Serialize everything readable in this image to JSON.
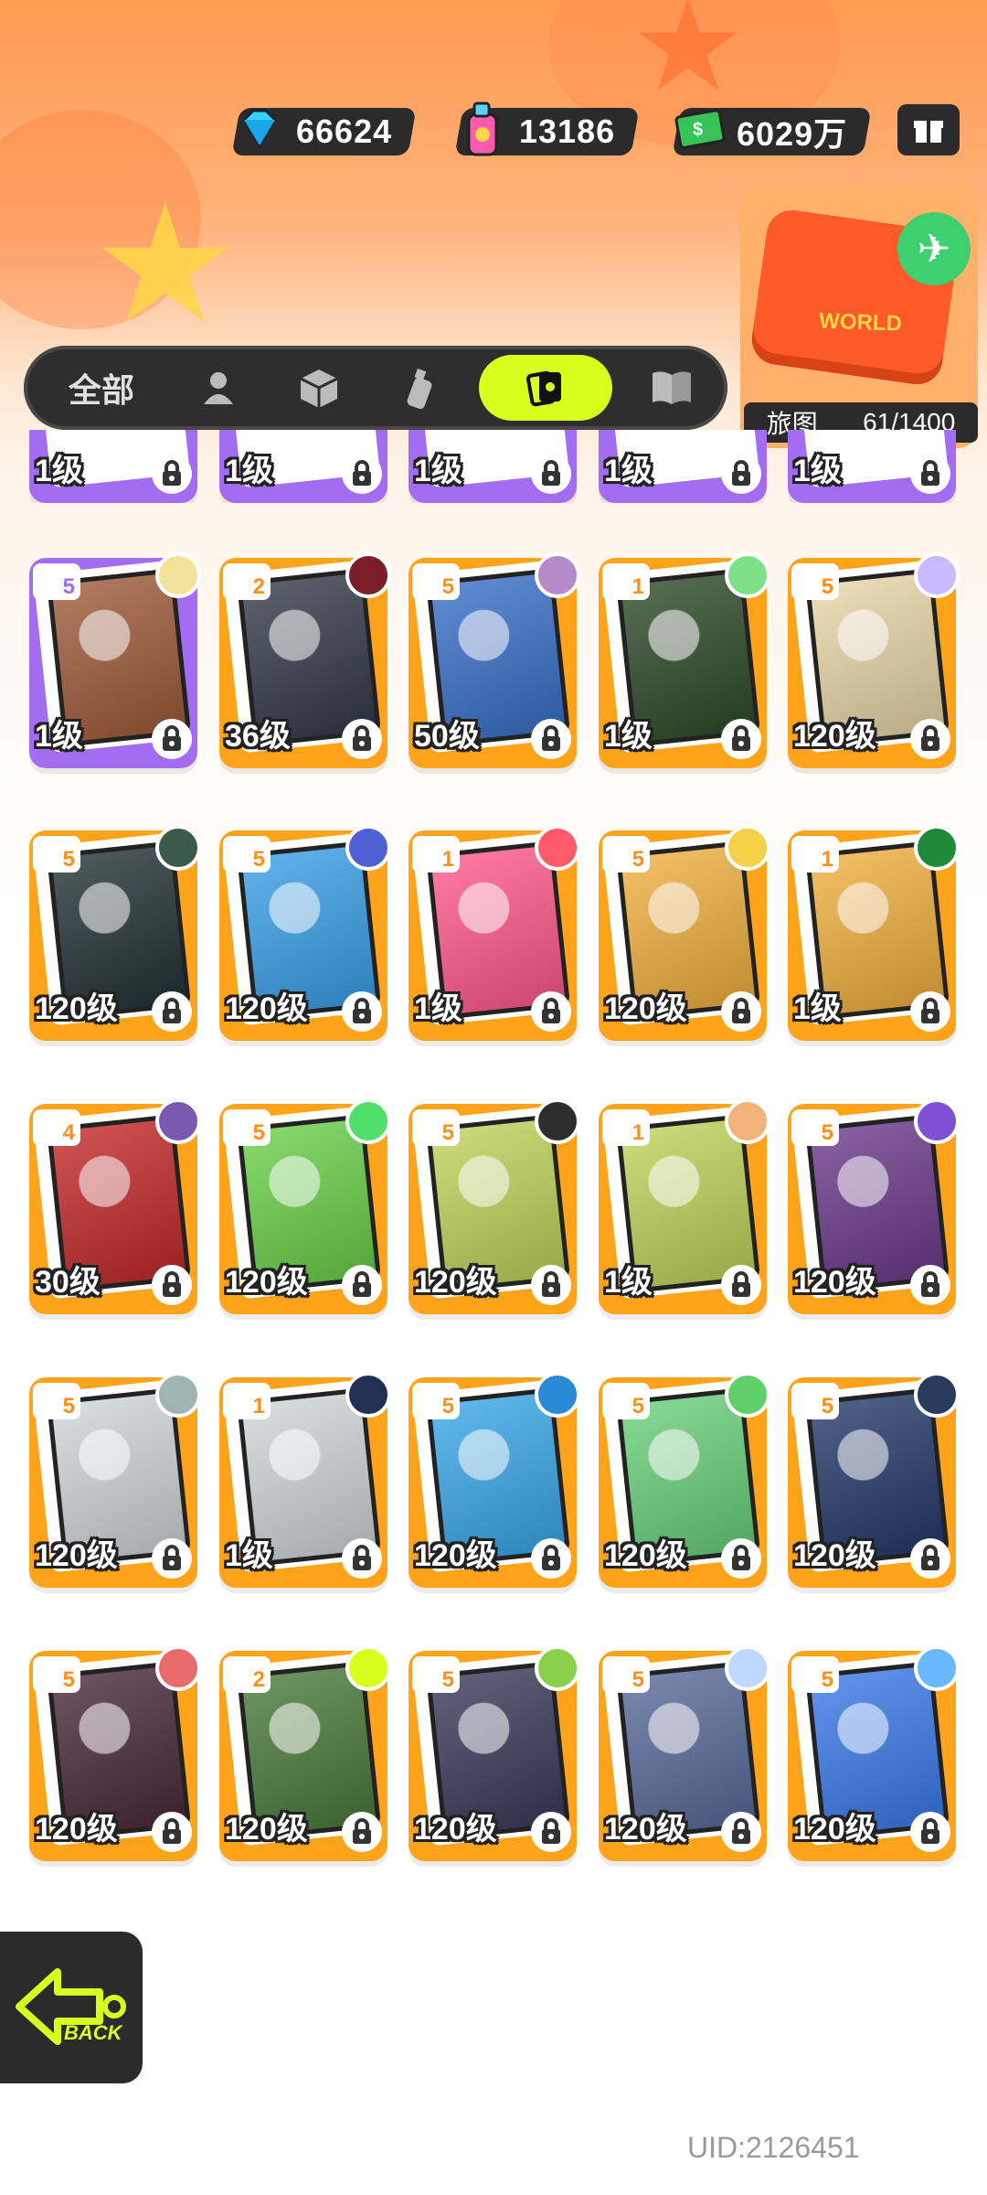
{
  "currencies": {
    "diamonds": "66624",
    "spray": "13186",
    "cash": "6029万"
  },
  "world": {
    "label": "旅图",
    "progress_text": "61/1400",
    "badge_text": "WORLD"
  },
  "tabs": [
    {
      "label": "全部",
      "icon": "all",
      "active": false
    },
    {
      "label": "",
      "icon": "person-icon",
      "active": false
    },
    {
      "label": "",
      "icon": "box-icon",
      "active": false
    },
    {
      "label": "",
      "icon": "spray-can-icon",
      "active": false
    },
    {
      "label": "",
      "icon": "cards-icon",
      "active": true
    },
    {
      "label": "",
      "icon": "book-icon",
      "active": false
    }
  ],
  "cards_top_partial": [
    {
      "level": "1级",
      "color": "purple"
    },
    {
      "level": "1级",
      "color": "purple"
    },
    {
      "level": "1级",
      "color": "purple"
    },
    {
      "level": "1级",
      "color": "purple"
    },
    {
      "level": "1级",
      "color": "purple"
    }
  ],
  "cards": [
    [
      {
        "level": "1级",
        "badge": "5",
        "color": "purple",
        "art": "#a05a3a",
        "avatar": "#f3e29a"
      },
      {
        "level": "36级",
        "badge": "2",
        "color": "orange",
        "art": "#333a4a",
        "avatar": "#7a1f2a"
      },
      {
        "level": "50级",
        "badge": "5",
        "color": "orange",
        "art": "#3a6fc9",
        "avatar": "#b58acb"
      },
      {
        "level": "1级",
        "badge": "1",
        "color": "orange",
        "art": "#2f4a2a",
        "avatar": "#7fe08a"
      },
      {
        "level": "120级",
        "badge": "5",
        "color": "orange",
        "art": "#e9d6a9",
        "avatar": "#c9b9ff"
      }
    ],
    [
      {
        "level": "120级",
        "badge": "5",
        "color": "orange",
        "art": "#243238",
        "avatar": "#3b5a4a"
      },
      {
        "level": "120级",
        "badge": "5",
        "color": "orange",
        "art": "#3aa0e8",
        "avatar": "#4f5fd6"
      },
      {
        "level": "1级",
        "badge": "1",
        "color": "orange",
        "art": "#ff5a8a",
        "avatar": "#ff5a6a"
      },
      {
        "level": "120级",
        "badge": "5",
        "color": "orange",
        "art": "#f0b040",
        "avatar": "#f7d04a"
      },
      {
        "level": "1级",
        "badge": "1",
        "color": "orange",
        "art": "#f0b040",
        "avatar": "#1f8a3a"
      }
    ],
    [
      {
        "level": "30级",
        "badge": "4",
        "color": "orange",
        "art": "#c22a2a",
        "avatar": "#7a5ab0"
      },
      {
        "level": "120级",
        "badge": "5",
        "color": "orange",
        "art": "#6ad04a",
        "avatar": "#4ee06a"
      },
      {
        "level": "120级",
        "badge": "5",
        "color": "orange",
        "art": "#c0d35a",
        "avatar": "#2d2d2d"
      },
      {
        "level": "1级",
        "badge": "1",
        "color": "orange",
        "art": "#c0d35a",
        "avatar": "#f2b27a"
      },
      {
        "level": "120级",
        "badge": "5",
        "color": "orange",
        "art": "#6a3a8a",
        "avatar": "#7f4fd6"
      }
    ],
    [
      {
        "level": "120级",
        "badge": "5",
        "color": "orange",
        "art": "#cfd6d8",
        "avatar": "#9fb5b0"
      },
      {
        "level": "1级",
        "badge": "1",
        "color": "orange",
        "art": "#cfd6d8",
        "avatar": "#233055"
      },
      {
        "level": "120级",
        "badge": "5",
        "color": "orange",
        "art": "#3aa7e8",
        "avatar": "#2a8ad6"
      },
      {
        "level": "120级",
        "badge": "5",
        "color": "orange",
        "art": "#6ad07a",
        "avatar": "#5fd06a"
      },
      {
        "level": "120级",
        "badge": "5",
        "color": "orange",
        "art": "#233a6a",
        "avatar": "#2a3a5a"
      }
    ],
    [
      {
        "level": "120级",
        "badge": "5",
        "color": "orange",
        "art": "#4a2a3a",
        "avatar": "#e86a6a"
      },
      {
        "level": "120级",
        "badge": "2",
        "color": "orange",
        "art": "#4a7a3a",
        "avatar": "#d8ff1d"
      },
      {
        "level": "120级",
        "badge": "5",
        "color": "orange",
        "art": "#3a3a5a",
        "avatar": "#8ad04a"
      },
      {
        "level": "120级",
        "badge": "5",
        "color": "orange",
        "art": "#5a6a9a",
        "avatar": "#c0d8ff"
      },
      {
        "level": "120级",
        "badge": "5",
        "color": "orange",
        "art": "#3a7ae8",
        "avatar": "#6ab8ff"
      }
    ]
  ],
  "back_label": "BACK",
  "uid": "UID:2126451"
}
